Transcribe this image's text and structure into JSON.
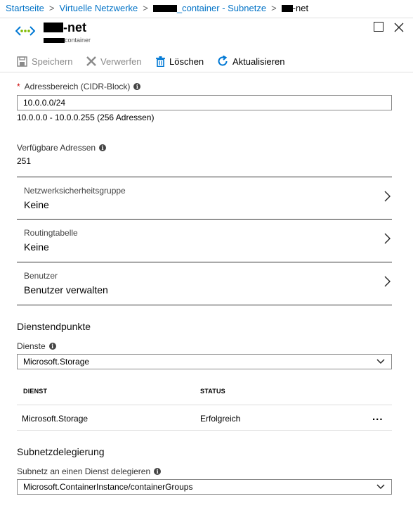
{
  "breadcrumb": {
    "items": [
      "Startseite",
      "Virtuelle Netzwerke",
      "_container - Subnetze",
      "-net"
    ]
  },
  "header": {
    "title": "-net",
    "subtitle": "container"
  },
  "toolbar": {
    "save_label": "Speichern",
    "discard_label": "Verwerfen",
    "delete_label": "Löschen",
    "refresh_label": "Aktualisieren"
  },
  "address_range": {
    "label": "Adressbereich (CIDR-Block)",
    "required_mark": "*",
    "value": "10.0.0.0/24",
    "range_text": "10.0.0.0 - 10.0.0.255 (256 Adressen)"
  },
  "available": {
    "label": "Verfügbare Adressen",
    "value": "251"
  },
  "nsg": {
    "label": "Netzwerksicherheitsgruppe",
    "value": "Keine"
  },
  "routing": {
    "label": "Routingtabelle",
    "value": "Keine"
  },
  "users": {
    "label": "Benutzer",
    "value": "Benutzer verwalten"
  },
  "service_endpoints": {
    "title": "Dienstendpunkte",
    "services_label": "Dienste",
    "services_value": "Microsoft.Storage",
    "columns": [
      "DIENST",
      "STATUS"
    ],
    "rows": [
      {
        "service": "Microsoft.Storage",
        "status": "Erfolgreich",
        "more": "..."
      }
    ]
  },
  "delegation": {
    "title": "Subnetzdelegierung",
    "label": "Subnetz an einen Dienst delegieren",
    "value": "Microsoft.ContainerInstance/containerGroups"
  },
  "colors": {
    "link": "#0072c6",
    "accent": "#0078d4",
    "required": "#cc0000"
  }
}
